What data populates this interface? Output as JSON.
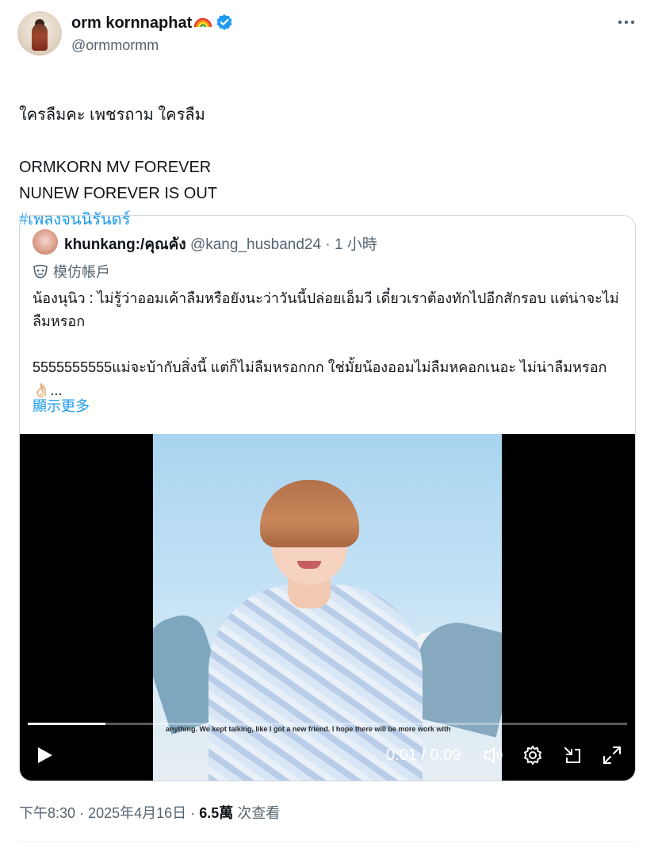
{
  "post": {
    "author": {
      "display_name": "orm kornnaphat",
      "handle": "@ormmormm",
      "verified": true,
      "name_emoji": "rainbow-icon"
    },
    "text_lines": "ใครลืมคะ เพชรถาม ใครลืม\n\nORMKORN MV FOREVER\nNUNEW FOREVER IS OUT",
    "hashtag": "#เพลงจนนิรันดร์",
    "more_icon": "more-icon"
  },
  "quote": {
    "author": {
      "display_name": "khunkang:/คุณคัง",
      "handle": "@kang_husband24",
      "separator": "·",
      "time": "1 小時"
    },
    "parody_label": "模仿帳戶",
    "text": "น้องนุนิว : ไม่รู้ว่าออมเค้าลืมหรือยังนะว่าวันนี้ปล่อยเอ็มวี เดี๋ยวเราต้องทักไปอีกสักรอบ แต่น่าจะไม่ลืมหรอก\n\n5555555555แม่จะบ้ากับสิ่งนี้ แต่ก็ไม่ลืมหรอกกก ใช่มั้ยน้องออมไม่ลืมหคอกเนอะ ไม่น่าลืมหรอก 👌🏻...",
    "show_more": "顯示更多"
  },
  "video": {
    "subtitle": "anything. We kept talking, like I got a new friend. I hope there will be more work with",
    "current_time": "0:01",
    "separator": "/",
    "duration": "0:09",
    "progress": 0.13,
    "controls": [
      "play-icon",
      "volume-icon",
      "settings-icon",
      "pip-icon",
      "fullscreen-icon"
    ]
  },
  "footer": {
    "time": "下午8:30",
    "dot1": "·",
    "date": "2025年4月16日",
    "dot2": "·",
    "views": "6.5萬",
    "views_label": "次查看"
  },
  "colors": {
    "accent": "#1d9bf0",
    "secondary_text": "#536471",
    "border": "#cfd9de"
  }
}
